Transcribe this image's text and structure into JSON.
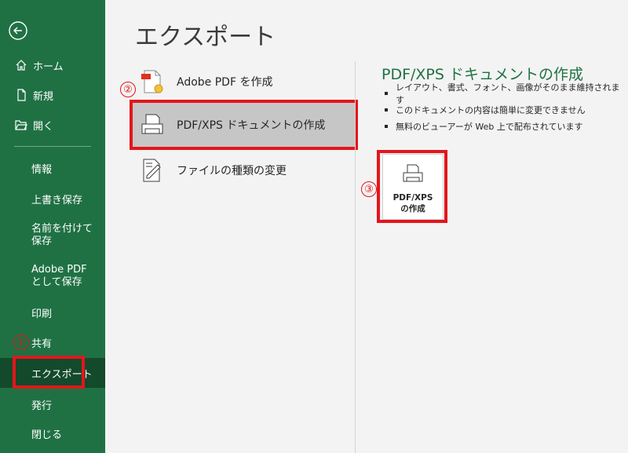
{
  "sidebar": {
    "top_items": [
      {
        "label": "ホーム",
        "icon": "home-icon"
      },
      {
        "label": "新規",
        "icon": "new-document-icon"
      },
      {
        "label": "開く",
        "icon": "folder-open-icon"
      }
    ],
    "items": [
      {
        "label": "情報"
      },
      {
        "label": "上書き保存"
      },
      {
        "label": "名前を付けて保存"
      },
      {
        "label": "Adobe PDF として保存"
      },
      {
        "label": "印刷"
      },
      {
        "label": "共有"
      },
      {
        "label": "エクスポート"
      },
      {
        "label": "発行"
      },
      {
        "label": "閉じる"
      }
    ]
  },
  "page": {
    "title": "エクスポート"
  },
  "options": [
    {
      "label": "Adobe PDF を作成",
      "icon": "adobe-pdf-icon"
    },
    {
      "label": "PDF/XPS ドキュメントの作成",
      "icon": "pdf-xps-document-icon"
    },
    {
      "label": "ファイルの種類の変更",
      "icon": "change-file-type-icon"
    }
  ],
  "detail": {
    "title": "PDF/XPS ドキュメントの作成",
    "bullets": [
      "レイアウト、書式、フォント、画像がそのまま維持されます",
      "このドキュメントの内容は簡単に変更できません",
      "無料のビューアーが Web 上で配布されています"
    ],
    "button_line1": "PDF/XPS",
    "button_line2": "の作成"
  },
  "annotations": {
    "step1": "①",
    "step2": "②",
    "step3": "③"
  },
  "colors": {
    "brand": "#1f7144",
    "selected_nav": "#134a2b",
    "highlight": "#e3161c"
  }
}
